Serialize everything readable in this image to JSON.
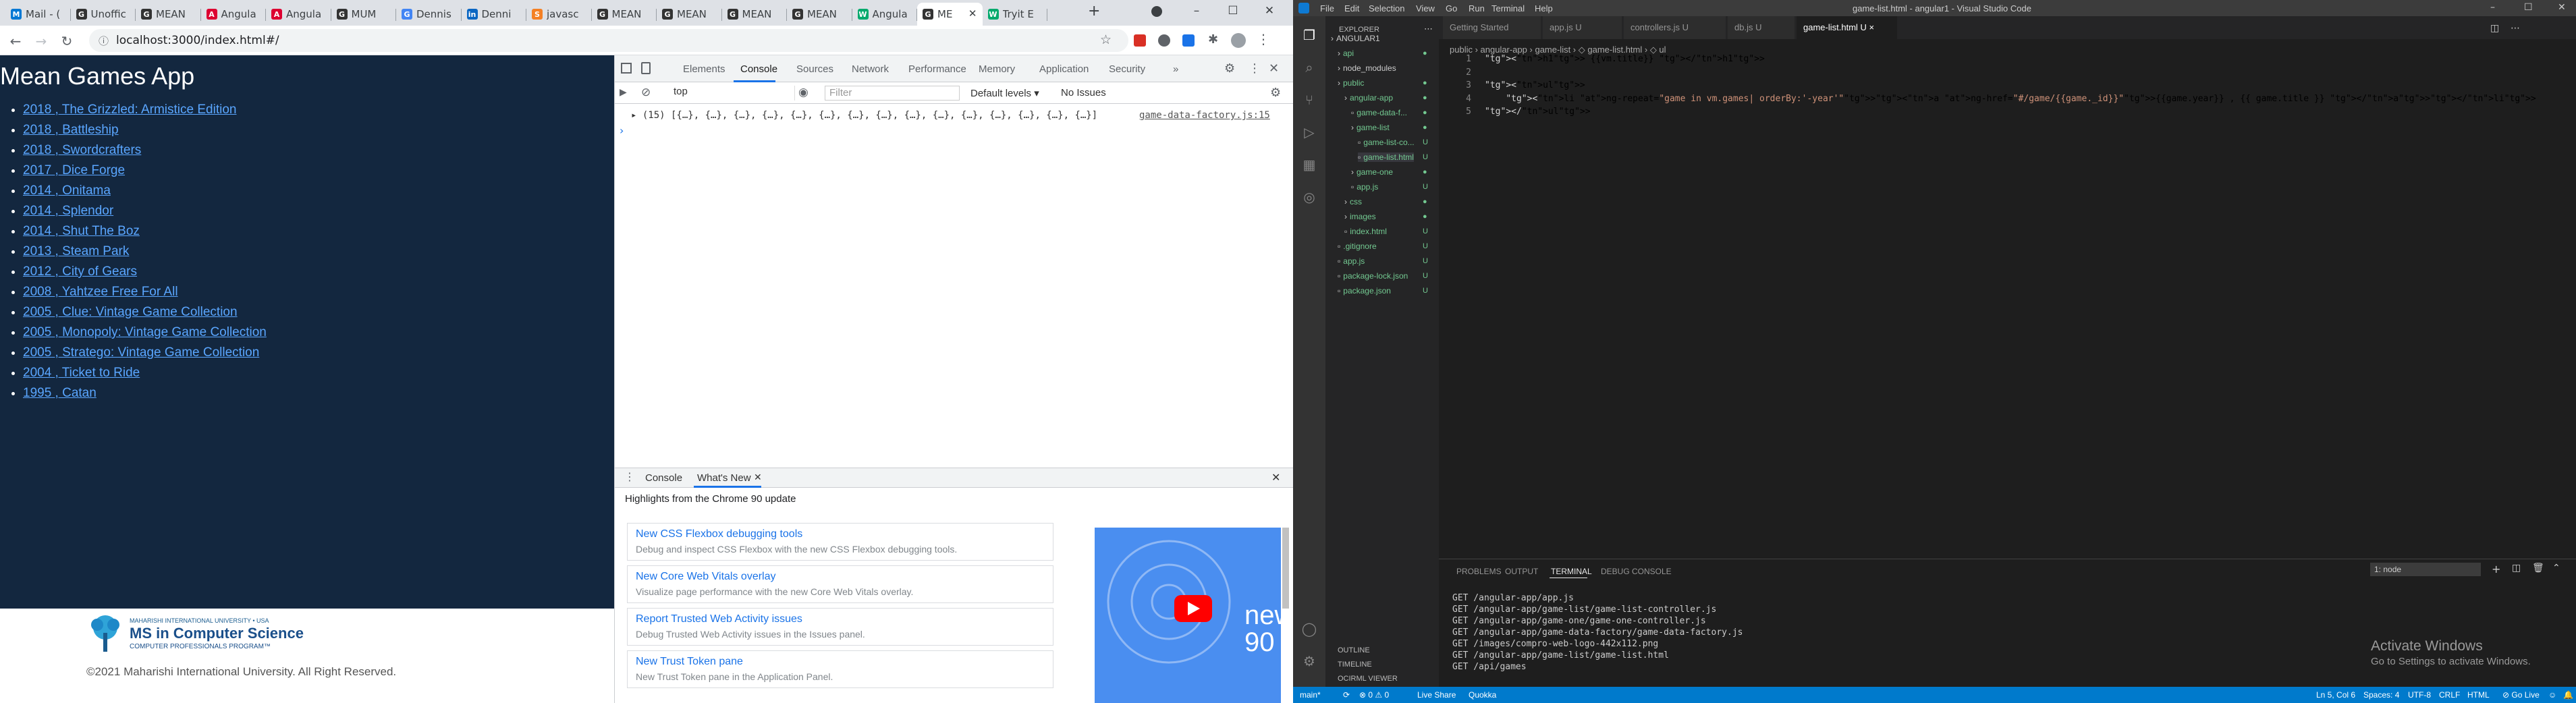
{
  "browser": {
    "tabs": [
      {
        "label": "Mail - (",
        "color": "#0078d4",
        "glyph": "M"
      },
      {
        "label": "Unoffic",
        "color": "#333333",
        "glyph": "G"
      },
      {
        "label": "MEAN",
        "color": "#333333",
        "glyph": "G"
      },
      {
        "label": "Angula",
        "color": "#dd0031",
        "glyph": "A"
      },
      {
        "label": "Angula",
        "color": "#dd0031",
        "glyph": "A"
      },
      {
        "label": "MUM",
        "color": "#333333",
        "glyph": "G"
      },
      {
        "label": "Dennis",
        "color": "#4285f4",
        "glyph": "G"
      },
      {
        "label": "Denni",
        "color": "#0a66c2",
        "glyph": "in"
      },
      {
        "label": "javasc",
        "color": "#f48024",
        "glyph": "S"
      },
      {
        "label": "MEAN",
        "color": "#333333",
        "glyph": "G"
      },
      {
        "label": "MEAN",
        "color": "#333333",
        "glyph": "G"
      },
      {
        "label": "MEAN",
        "color": "#333333",
        "glyph": "G"
      },
      {
        "label": "MEAN",
        "color": "#333333",
        "glyph": "G"
      },
      {
        "label": "Angula",
        "color": "#04aa6d",
        "glyph": "W"
      },
      {
        "label": "ME",
        "color": "#333333",
        "glyph": "G"
      },
      {
        "label": "Tryit E",
        "color": "#04aa6d",
        "glyph": "W"
      }
    ],
    "new_tab_label": "+",
    "url": "localhost:3000/index.html#/"
  },
  "app": {
    "title": "Mean Games App",
    "games": [
      "2018 , The Grizzled: Armistice Edition",
      "2018 , Battleship",
      "2018 , Swordcrafters",
      "2017 , Dice Forge",
      "2014 , Onitama",
      "2014 , Splendor",
      "2014 , Shut The Boz",
      "2013 , Steam Park",
      "2012 , City of Gears",
      "2008 , Yahtzee Free For All",
      "2005 , Clue: Vintage Game Collection",
      "2005 , Monopoly: Vintage Game Collection",
      "2005 , Stratego: Vintage Game Collection",
      "2004 , Ticket to Ride",
      "1995 , Catan"
    ],
    "footer": {
      "small": "MAHARISHI INTERNATIONAL UNIVERSITY • USA",
      "big": "MS in Computer Science",
      "sub": "COMPUTER PROFESSIONALS PROGRAM™",
      "copyright": "©2021 Maharishi International University. All Right Reserved."
    }
  },
  "devtools": {
    "tabs": [
      "Elements",
      "Console",
      "Sources",
      "Network",
      "Performance",
      "Memory",
      "Application",
      "Security"
    ],
    "more": "»",
    "context": "top",
    "filter_placeholder": "Filter",
    "levels": "Default levels ▾",
    "issues": "No Issues",
    "log": "▸ (15) [{…}, {…}, {…}, {…}, {…}, {…}, {…}, {…}, {…}, {…}, {…}, {…}, {…}, {…}, {…}]",
    "log_source": "game-data-factory.js:15",
    "prompt": "›",
    "drawer_tabs": [
      "Console",
      "What's New"
    ],
    "highlights": "Highlights from the Chrome 90 update",
    "cards": [
      {
        "title": "New CSS Flexbox debugging tools",
        "desc": "Debug and inspect CSS Flexbox with the new CSS Flexbox debugging tools."
      },
      {
        "title": "New Core Web Vitals overlay",
        "desc": "Visualize page performance with the new Core Web Vitals overlay."
      },
      {
        "title": "Report Trusted Web Activity issues",
        "desc": "Debug Trusted Web Activity issues in the Issues panel."
      },
      {
        "title": "New Trust Token pane",
        "desc": "New Trust Token pane in the Application Panel."
      }
    ],
    "video_text": "new 90"
  },
  "vscode": {
    "menu": [
      "File",
      "Edit",
      "Selection",
      "View",
      "Go",
      "Run",
      "Terminal",
      "Help"
    ],
    "window_title": "game-list.html - angular1 - Visual Studio Code",
    "explorer_header": "EXPLORER",
    "tree": [
      {
        "label": "ANGULAR1",
        "indent": 0,
        "badge": ""
      },
      {
        "label": "api",
        "indent": 1,
        "badge": "●"
      },
      {
        "label": "node_modules",
        "indent": 1,
        "badge": ""
      },
      {
        "label": "public",
        "indent": 1,
        "badge": "●"
      },
      {
        "label": "angular-app",
        "indent": 2,
        "badge": "●"
      },
      {
        "label": "game-data-f...",
        "indent": 3,
        "badge": "●"
      },
      {
        "label": "game-list",
        "indent": 3,
        "badge": "●"
      },
      {
        "label": "game-list-co...",
        "indent": 4,
        "badge": "U"
      },
      {
        "label": "game-list.html",
        "indent": 4,
        "badge": "U"
      },
      {
        "label": "game-one",
        "indent": 3,
        "badge": "●"
      },
      {
        "label": "app.js",
        "indent": 3,
        "badge": "U"
      },
      {
        "label": "css",
        "indent": 2,
        "badge": "●"
      },
      {
        "label": "images",
        "indent": 2,
        "badge": "●"
      },
      {
        "label": "index.html",
        "indent": 2,
        "badge": "U"
      },
      {
        "label": ".gitignore",
        "indent": 1,
        "badge": "U"
      },
      {
        "label": "app.js",
        "indent": 1,
        "badge": "U"
      },
      {
        "label": "package-lock.json",
        "indent": 1,
        "badge": "U"
      },
      {
        "label": "package.json",
        "indent": 1,
        "badge": "U"
      }
    ],
    "outline": [
      "OUTLINE",
      "TIMELINE",
      "OCIRML VIEWER"
    ],
    "editor_tabs": [
      {
        "label": "Getting Started"
      },
      {
        "label": "app.js  U"
      },
      {
        "label": "controllers.js  U"
      },
      {
        "label": "db.js  U"
      },
      {
        "label": "game-list.html  U  ×"
      }
    ],
    "breadcrumb": "public › angular-app › game-list › ◇ game-list.html › ◇ ul",
    "code": [
      {
        "n": "1",
        "text": "<h1> {{vm.title}} </h1>"
      },
      {
        "n": "2",
        "text": ""
      },
      {
        "n": "3",
        "text": "<ul>"
      },
      {
        "n": "4",
        "text": "    <li ng-repeat=\"game in vm.games| orderBy:'-year'\"><a ng-href=\"#/game/{{game._id}}\">{{game.year}} , {{ game.title }} </a></li>"
      },
      {
        "n": "5",
        "text": "</ul>"
      }
    ],
    "panel_tabs": [
      "PROBLEMS",
      "OUTPUT",
      "TERMINAL",
      "DEBUG CONSOLE"
    ],
    "terminal_select": "1: node",
    "terminal": [
      "GET /angular-app/app.js",
      "GET /angular-app/game-list/game-list-controller.js",
      "GET /angular-app/game-one/game-one-controller.js",
      "GET /angular-app/game-data-factory/game-data-factory.js",
      "GET /images/compro-web-logo-442x112.png",
      "GET /angular-app/game-list/game-list.html",
      "GET /api/games"
    ],
    "activate": {
      "title": "Activate Windows",
      "sub": "Go to Settings to activate Windows."
    },
    "status": {
      "branch": "main*",
      "sync": "⟳",
      "problems": "⊗ 0 ⚠ 0",
      "live": "Live Share",
      "quokka": "Quokka",
      "pos": "Ln 5, Col 6",
      "spaces": "Spaces: 4",
      "enc": "UTF-8",
      "eol": "CRLF",
      "lang": "HTML",
      "golive": "⊘ Go Live"
    }
  }
}
